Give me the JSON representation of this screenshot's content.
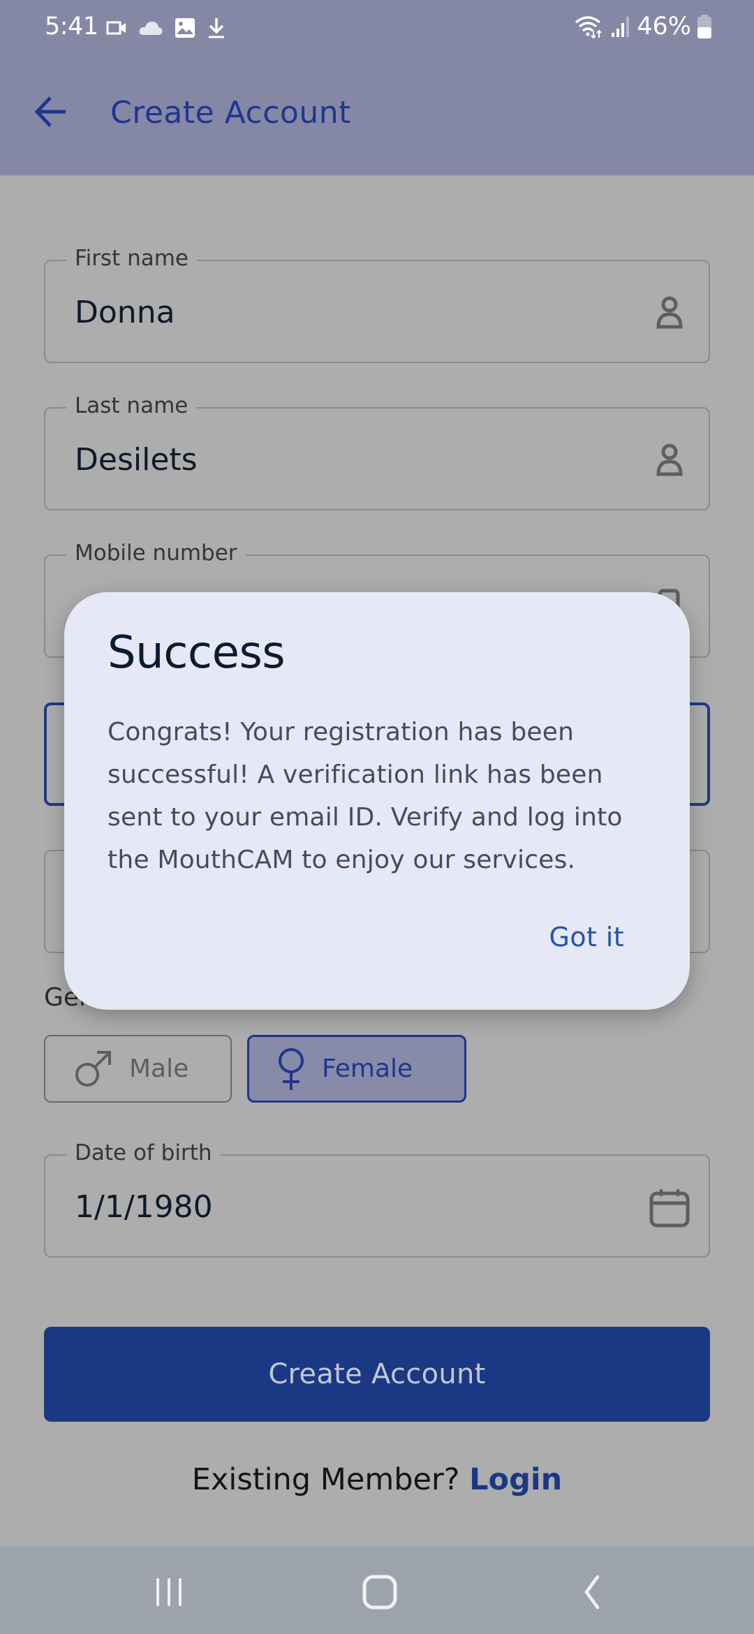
{
  "status_bar": {
    "time": "5:41",
    "left_icons": [
      "video-camera-icon",
      "cloud-icon",
      "image-icon",
      "download-icon"
    ],
    "right_icons": [
      "wifi-icon",
      "signal-icon"
    ],
    "battery_percent": "46%"
  },
  "app_bar": {
    "back_icon": "arrow-left-icon",
    "title": "Create Account"
  },
  "form": {
    "first_name": {
      "label": "First name",
      "value": "Donna",
      "icon": "person-icon"
    },
    "last_name": {
      "label": "Last name",
      "value": "Desilets",
      "icon": "person-icon"
    },
    "mobile_number": {
      "label": "Mobile number",
      "value": "",
      "icon": "phone-icon"
    },
    "gender": {
      "label": "Gender",
      "options": [
        {
          "label": "Male",
          "icon": "male-symbol-icon",
          "selected": false
        },
        {
          "label": "Female",
          "icon": "female-symbol-icon",
          "selected": true
        }
      ]
    },
    "date_of_birth": {
      "label": "Date of birth",
      "value": "1/1/1980",
      "icon": "calendar-icon"
    },
    "submit_label": "Create Account",
    "existing_member_text": "Existing Member?",
    "login_link": "Login"
  },
  "dialog": {
    "title": "Success",
    "message": "Congrats! Your registration has been successful! A verification link has been sent to your email ID. Verify and log into the MouthCAM to enjoy our services.",
    "action_label": "Got it"
  },
  "nav_bar": {
    "buttons": [
      "recent-apps-icon",
      "home-icon",
      "back-icon"
    ]
  },
  "colors": {
    "primary": "#1b3885",
    "header_bg": "#8588a5",
    "dialog_bg": "#e6e8f6",
    "dialog_action": "#2453ad",
    "scrim_bg": "#adadad"
  }
}
